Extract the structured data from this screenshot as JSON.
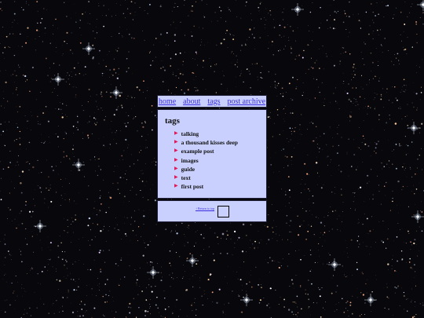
{
  "nav": {
    "home": "home",
    "about": "about",
    "tags": "tags",
    "archive": "post archive"
  },
  "content": {
    "heading": "tags",
    "tags": [
      "talking",
      "a thousand kisses deep",
      "example post",
      "images",
      "guide",
      "text",
      "first post"
    ]
  },
  "footer": {
    "link": "↑ Return to top"
  },
  "colors": {
    "panel_bg": "#c9d0fd",
    "link": "#3b2ee0",
    "bullet": "#e0195a",
    "space_bg": "#07070c"
  },
  "icons": {
    "bullet": "triangle-right-icon",
    "footer_box": "square-icon"
  }
}
